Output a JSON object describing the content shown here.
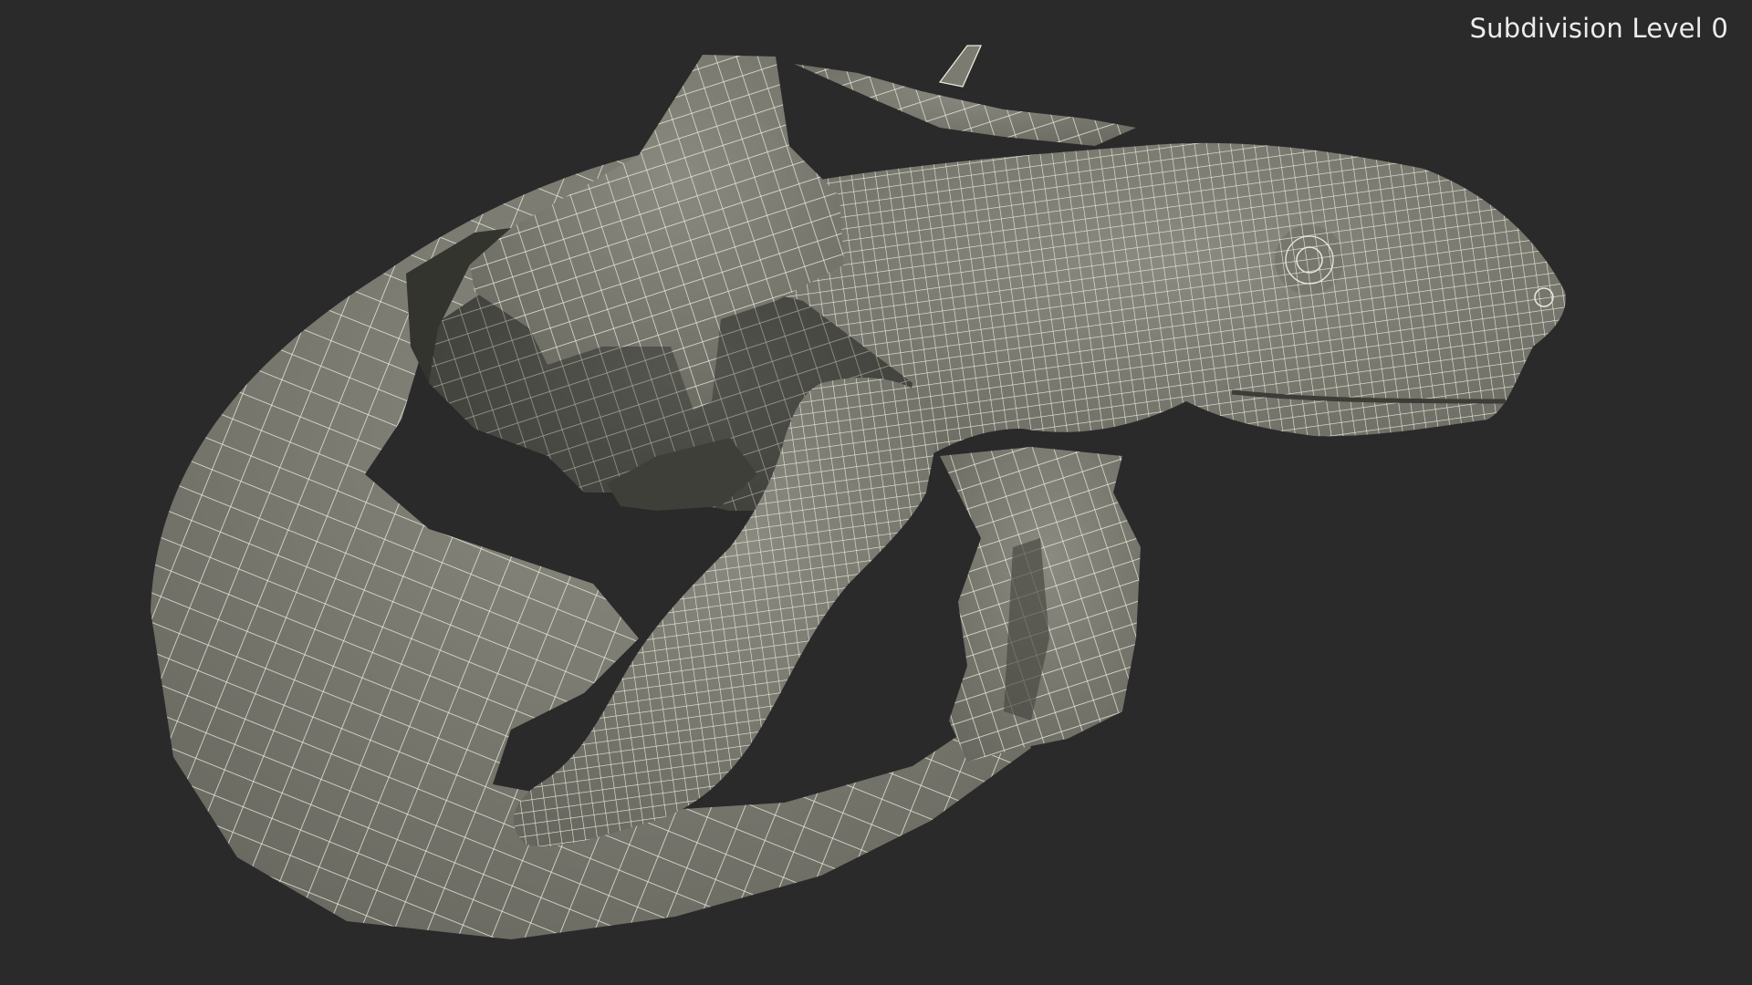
{
  "viewport": {
    "overlay_label": "Subdivision Level 0",
    "background_color": "#2a2a2a",
    "mesh_fill_color": "#7b7b72",
    "wireframe_color": "#e9e9dc"
  }
}
